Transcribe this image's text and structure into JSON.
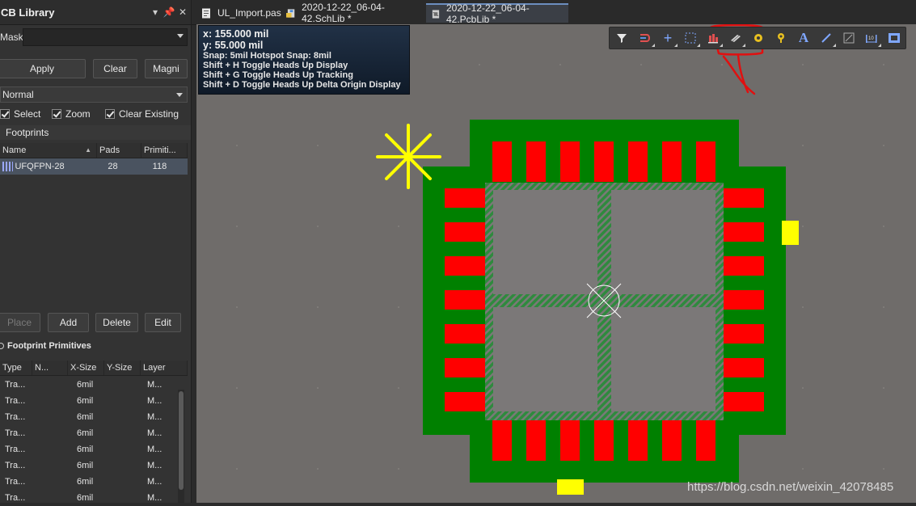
{
  "panel": {
    "title": "CB Library",
    "mask_label": "Mask",
    "mask_value": "",
    "buttons": {
      "apply": "Apply",
      "clear": "Clear",
      "magnify": "Magni"
    },
    "mode": "Normal",
    "checks": {
      "select": "Select",
      "zoom": "Zoom",
      "clear_existing": "Clear Existing"
    },
    "footprints_header": "Footprints",
    "fp_columns": {
      "name": "Name",
      "pads": "Pads",
      "primitives": "Primiti..."
    },
    "fp_rows": [
      {
        "name": "UFQFPN-28",
        "pads": "28",
        "primitives": "118"
      }
    ],
    "actions": {
      "place": "Place",
      "add": "Add",
      "delete": "Delete",
      "edit": "Edit"
    },
    "primitives_header": "Footprint Primitives",
    "prim_columns": {
      "type": "Type",
      "name": "N...",
      "xsize": "X-Size",
      "ysize": "Y-Size",
      "layer": "Layer"
    },
    "prim_rows": [
      {
        "type": "Tra...",
        "xsize": "6mil",
        "layer": "M..."
      },
      {
        "type": "Tra...",
        "xsize": "6mil",
        "layer": "M..."
      },
      {
        "type": "Tra...",
        "xsize": "6mil",
        "layer": "M..."
      },
      {
        "type": "Tra...",
        "xsize": "6mil",
        "layer": "M..."
      },
      {
        "type": "Tra...",
        "xsize": "6mil",
        "layer": "M..."
      },
      {
        "type": "Tra...",
        "xsize": "6mil",
        "layer": "M..."
      },
      {
        "type": "Tra...",
        "xsize": "6mil",
        "layer": "M..."
      },
      {
        "type": "Tra...",
        "xsize": "6mil",
        "layer": "M..."
      }
    ]
  },
  "tabs": [
    {
      "label": "UL_Import.pas"
    },
    {
      "label": "2020-12-22_06-04-42.SchLib *"
    },
    {
      "label": "2020-12-22_06-04-42.PcbLib *"
    }
  ],
  "hud": {
    "x_line": "x:   155.000 mil",
    "y_line": "y:    55.000  mil",
    "snap": "Snap: 5mil Hotspot Snap: 8mil",
    "h1": "Shift + H  Toggle Heads Up Display",
    "h2": "Shift + G  Toggle Heads Up Tracking",
    "h3": "Shift + D  Toggle Heads Up Delta Origin Display"
  },
  "toolbar_icons": [
    "filter-icon",
    "route-icon",
    "cross-icon",
    "select-rect-icon",
    "align-icon",
    "component-icon",
    "pad-icon",
    "via-icon",
    "text-icon",
    "line-icon",
    "rect-icon",
    "dimension-icon",
    "region-icon"
  ],
  "watermark": "https://blog.csdn.net/weixin_42078485",
  "colors": {
    "copper": "#008000",
    "pad": "#ff0000",
    "hatch": "#2a7a3a",
    "marker": "#ffff00",
    "annotation": "#e01010"
  }
}
